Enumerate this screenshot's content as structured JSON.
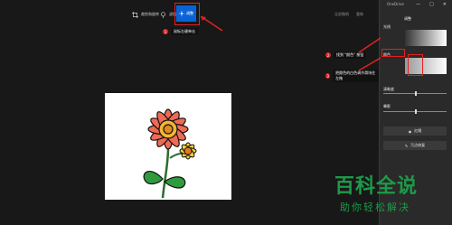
{
  "window": {
    "app_title": "OneDrive",
    "controls": [
      "—",
      "□",
      "✕"
    ]
  },
  "toolbar": {
    "crop_label": "裁剪和旋转",
    "filter_label": "滤镜",
    "adjust_label": "调整",
    "undo_label": "全部撤销",
    "redo_label": "重做"
  },
  "callouts": [
    {
      "num": "1",
      "text": "鼠标左键单击"
    },
    {
      "num": "2",
      "text": "找到 \"颜色\" 按钮"
    },
    {
      "num": "3",
      "text": "把颜色的白色调节滑块往左拖"
    }
  ],
  "panel": {
    "title": "调整",
    "light_label": "光线",
    "color_label": "颜色",
    "clarity_label": "清晰度",
    "vignette_label": "晕影",
    "redeye_label": "红眼",
    "spot_fix_label": "污点修复",
    "clarity_level": 0.5,
    "vignette_level": 0.5
  },
  "watermark": {
    "main": "百科全说",
    "sub": "助你轻松解决"
  },
  "colors": {
    "accent": "#0a63d6",
    "annotation": "#e32121",
    "brand": "#1d9a48"
  }
}
